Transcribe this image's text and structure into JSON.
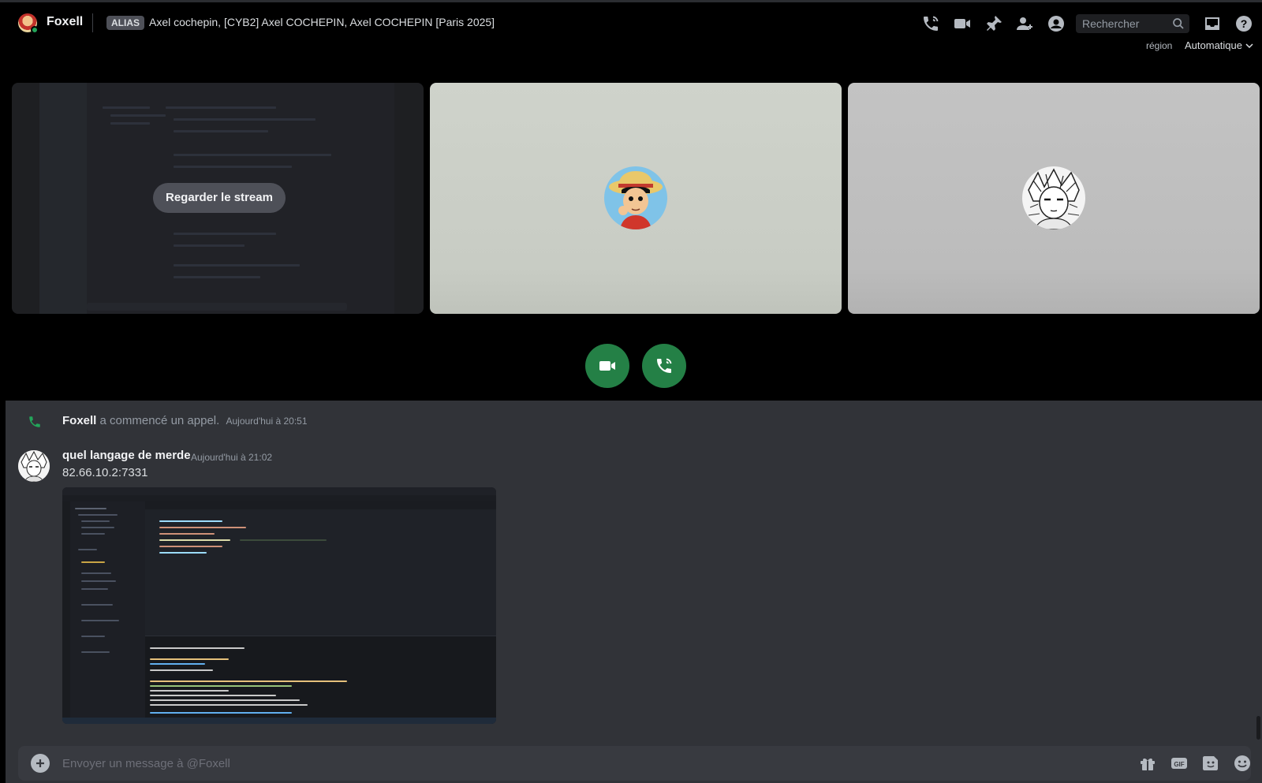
{
  "header": {
    "dm_name": "Foxell",
    "alias_badge": "ALIAS",
    "alias_text": "Axel cochepin, [CYB2] Axel COCHEPIN, Axel COCHEPIN [Paris 2025]",
    "icons": [
      "phone-call-icon",
      "video-icon",
      "pin-icon",
      "add-friend-icon",
      "user-profile-icon",
      "inbox-icon",
      "help-icon"
    ],
    "search_placeholder": "Rechercher"
  },
  "region": {
    "label": "région",
    "value": "Automatique"
  },
  "call": {
    "watch_stream_label": "Regarder le stream",
    "tiles": [
      "stream",
      "luffy-avatar",
      "manga-avatar"
    ],
    "controls": [
      "video-button",
      "hangup-button"
    ],
    "accent_color": "#248046"
  },
  "messages": {
    "system": {
      "author": "Foxell",
      "text": "a commencé un appel.",
      "timestamp": "Aujourd'hui à 20:51"
    },
    "message": {
      "author": "quel langage de merde",
      "timestamp": "Aujourd'hui à 21:02",
      "text": "82.66.10.2:7331",
      "attachment": "code-editor-screenshot"
    }
  },
  "composer": {
    "placeholder": "Envoyer un message à @Foxell",
    "icons": [
      "gift-icon",
      "gif-icon",
      "sticker-icon",
      "emoji-icon"
    ]
  }
}
